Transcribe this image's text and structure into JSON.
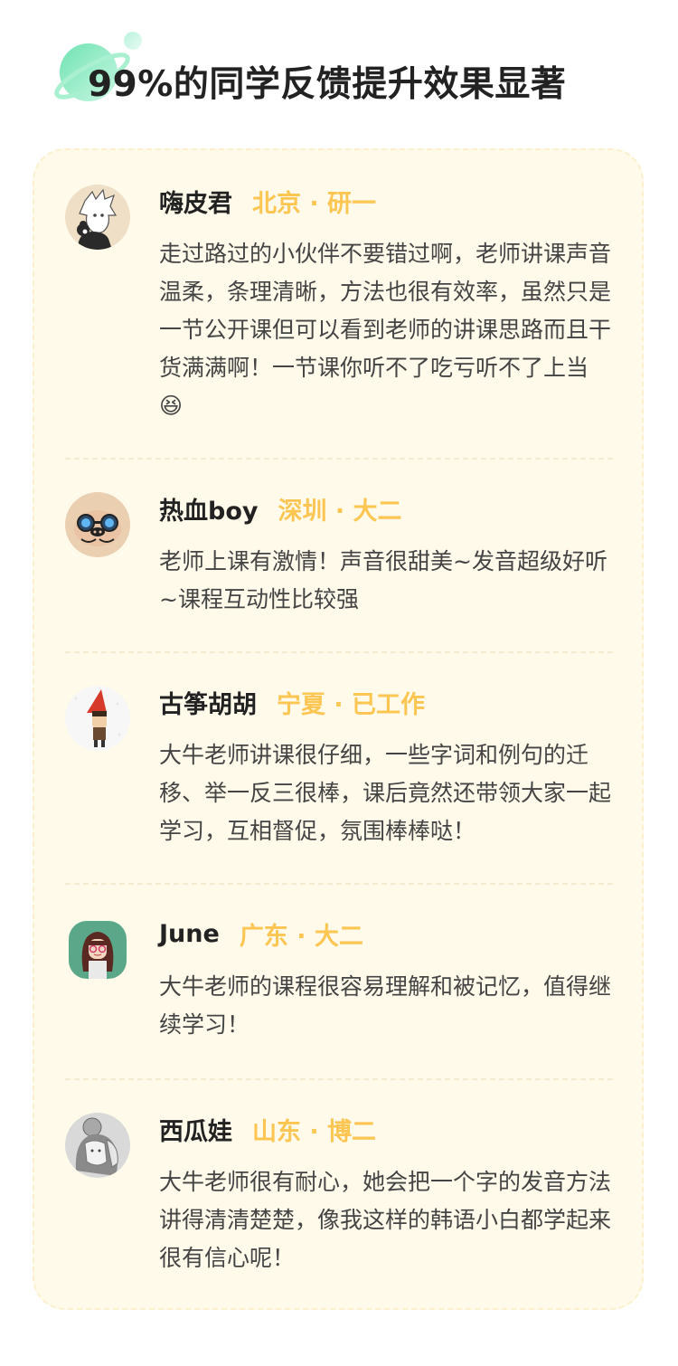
{
  "header": {
    "title": "99%的同学反馈提升效果显著",
    "icon": "planet-icon"
  },
  "colors": {
    "location": "#fdc552",
    "card_bg": "#fffaea",
    "name": "#222222",
    "comment": "#444444",
    "accent_green": "#5fe0a0"
  },
  "reviews": [
    {
      "name": "嗨皮君",
      "location": "北京 · 研一",
      "comment": "走过路过的小伙伴不要错过啊，老师讲课声音温柔，条理清晰，方法也很有效率，虽然只是一节公开课但可以看到老师的讲课思路而且干货满满啊！一节课你听不了吃亏听不了上当😆",
      "avatar": "anime-boy-avatar"
    },
    {
      "name": "热血boy",
      "location": "深圳 · 大二",
      "comment": "老师上课有激情！声音很甜美~发音超级好听~课程互动性比较强",
      "avatar": "pig-goggles-avatar"
    },
    {
      "name": "古筝胡胡",
      "location": "宁夏 · 已工作",
      "comment": "大牛老师讲课很仔细，一些字词和例句的迁移、举一反三很棒，课后竟然还带领大家一起学习，互相督促，氛围棒棒哒！",
      "avatar": "witch-hat-avatar"
    },
    {
      "name": "June",
      "location": "广东 · 大二",
      "comment": "大牛老师的课程很容易理解和被记忆，值得继续学习！",
      "avatar": "girl-glasses-avatar"
    },
    {
      "name": "西瓜娃",
      "location": "山东 · 博二",
      "comment": "大牛老师很有耐心，她会把一个字的发音方法讲得清清楚楚，像我这样的韩语小白都学起来很有信心呢！",
      "avatar": "sketch-girl-avatar"
    }
  ]
}
